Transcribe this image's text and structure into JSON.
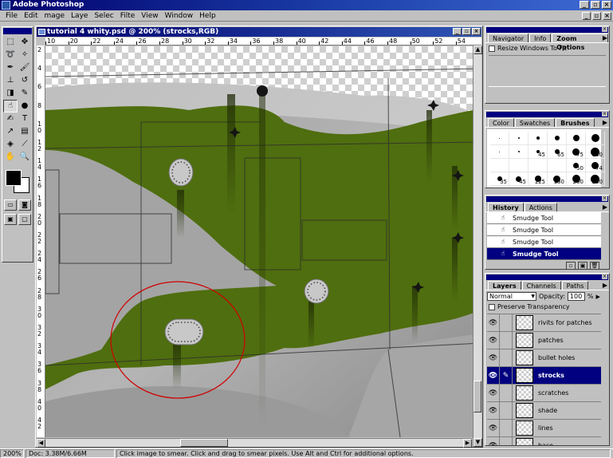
{
  "app": {
    "title": "Adobe Photoshop",
    "window_buttons": [
      "_",
      "▫",
      "×"
    ]
  },
  "menu": {
    "items": [
      "File",
      "Edit",
      "mage",
      "Laye",
      "Selec",
      "Filte",
      "View",
      "Window",
      "Help"
    ]
  },
  "toolbox": {
    "tools": [
      {
        "name": "marquee-tool-icon",
        "glyph": "⬚"
      },
      {
        "name": "move-tool-icon",
        "glyph": "✥"
      },
      {
        "name": "lasso-tool-icon",
        "glyph": "➰"
      },
      {
        "name": "magic-wand-icon",
        "glyph": "✧"
      },
      {
        "name": "airbrush-tool-icon",
        "glyph": "✒"
      },
      {
        "name": "paintbrush-tool-icon",
        "glyph": "🖌"
      },
      {
        "name": "rubber-stamp-icon",
        "glyph": "⊥"
      },
      {
        "name": "history-brush-icon",
        "glyph": "↺"
      },
      {
        "name": "eraser-tool-icon",
        "glyph": "◨"
      },
      {
        "name": "pencil-tool-icon",
        "glyph": "✎"
      },
      {
        "name": "smudge-tool-icon",
        "glyph": "☝"
      },
      {
        "name": "dodge-tool-icon",
        "glyph": "●"
      },
      {
        "name": "pen-tool-icon",
        "glyph": "✍"
      },
      {
        "name": "type-tool-icon",
        "glyph": "T"
      },
      {
        "name": "measure-tool-icon",
        "glyph": "↗"
      },
      {
        "name": "gradient-tool-icon",
        "glyph": "▤"
      },
      {
        "name": "paint-bucket-icon",
        "glyph": "◈"
      },
      {
        "name": "eyedropper-icon",
        "glyph": "⟋"
      },
      {
        "name": "hand-tool-icon",
        "glyph": "✋"
      },
      {
        "name": "zoom-tool-icon",
        "glyph": "🔍"
      }
    ],
    "active_tool": 10
  },
  "document": {
    "title": "tutorial 4 whity.psd @ 200% (strocks,RGB)",
    "ruler_h": [
      "10",
      "20",
      "22",
      "24",
      "26",
      "28",
      "30",
      "32",
      "34",
      "36",
      "38",
      "40",
      "42",
      "44",
      "46",
      "48",
      "50",
      "52",
      "54"
    ],
    "ruler_v": [
      "2",
      "4",
      "6",
      "8",
      "10",
      "12",
      "14",
      "16",
      "18",
      "20",
      "22",
      "24",
      "26",
      "28",
      "30",
      "32",
      "34",
      "36",
      "38",
      "40",
      "42"
    ]
  },
  "navigator_panel": {
    "tabs": [
      "Navigator",
      "Info",
      "Zoom Options"
    ],
    "active_tab": 2,
    "option_label": "Resize Windows To Fit"
  },
  "brushes_panel": {
    "tabs": [
      "Color",
      "Swatches",
      "Brushes"
    ],
    "active_tab": 2,
    "labels": [
      "45",
      "65",
      "75",
      "100",
      "50",
      "74",
      "35",
      "45",
      "125",
      "150",
      "200",
      "300"
    ]
  },
  "history_panel": {
    "tabs": [
      "History",
      "Actions"
    ],
    "active_tab": 0,
    "items": [
      "Smudge Tool",
      "Smudge Tool",
      "Smudge Tool",
      "Smudge Tool"
    ],
    "selected": 3
  },
  "layers_panel": {
    "tabs": [
      "Layers",
      "Channels",
      "Paths"
    ],
    "active_tab": 0,
    "blend_mode": "Normal",
    "opacity_label": "Opacity:",
    "opacity_value": "100",
    "opacity_unit": "%",
    "preserve_label": "Preserve Transparency",
    "layers": [
      {
        "name": "rivits for patches",
        "visible": true,
        "active": false
      },
      {
        "name": "patches",
        "visible": true,
        "active": false
      },
      {
        "name": "bullet holes",
        "visible": true,
        "active": false
      },
      {
        "name": "strocks",
        "visible": true,
        "active": true
      },
      {
        "name": "scratches",
        "visible": true,
        "active": false
      },
      {
        "name": "shade",
        "visible": true,
        "active": false
      },
      {
        "name": "lines",
        "visible": true,
        "active": false
      },
      {
        "name": "base",
        "visible": true,
        "active": false
      }
    ]
  },
  "status": {
    "zoom": "200%",
    "doc_size": "Doc: 3.38M/6.66M",
    "hint": "Click image to smear. Click and drag to smear pixels. Use Alt and Ctrl for additional options."
  },
  "colors": {
    "annotation": "#d00000",
    "olive": "#4f6e0f",
    "selection": "#000080"
  }
}
